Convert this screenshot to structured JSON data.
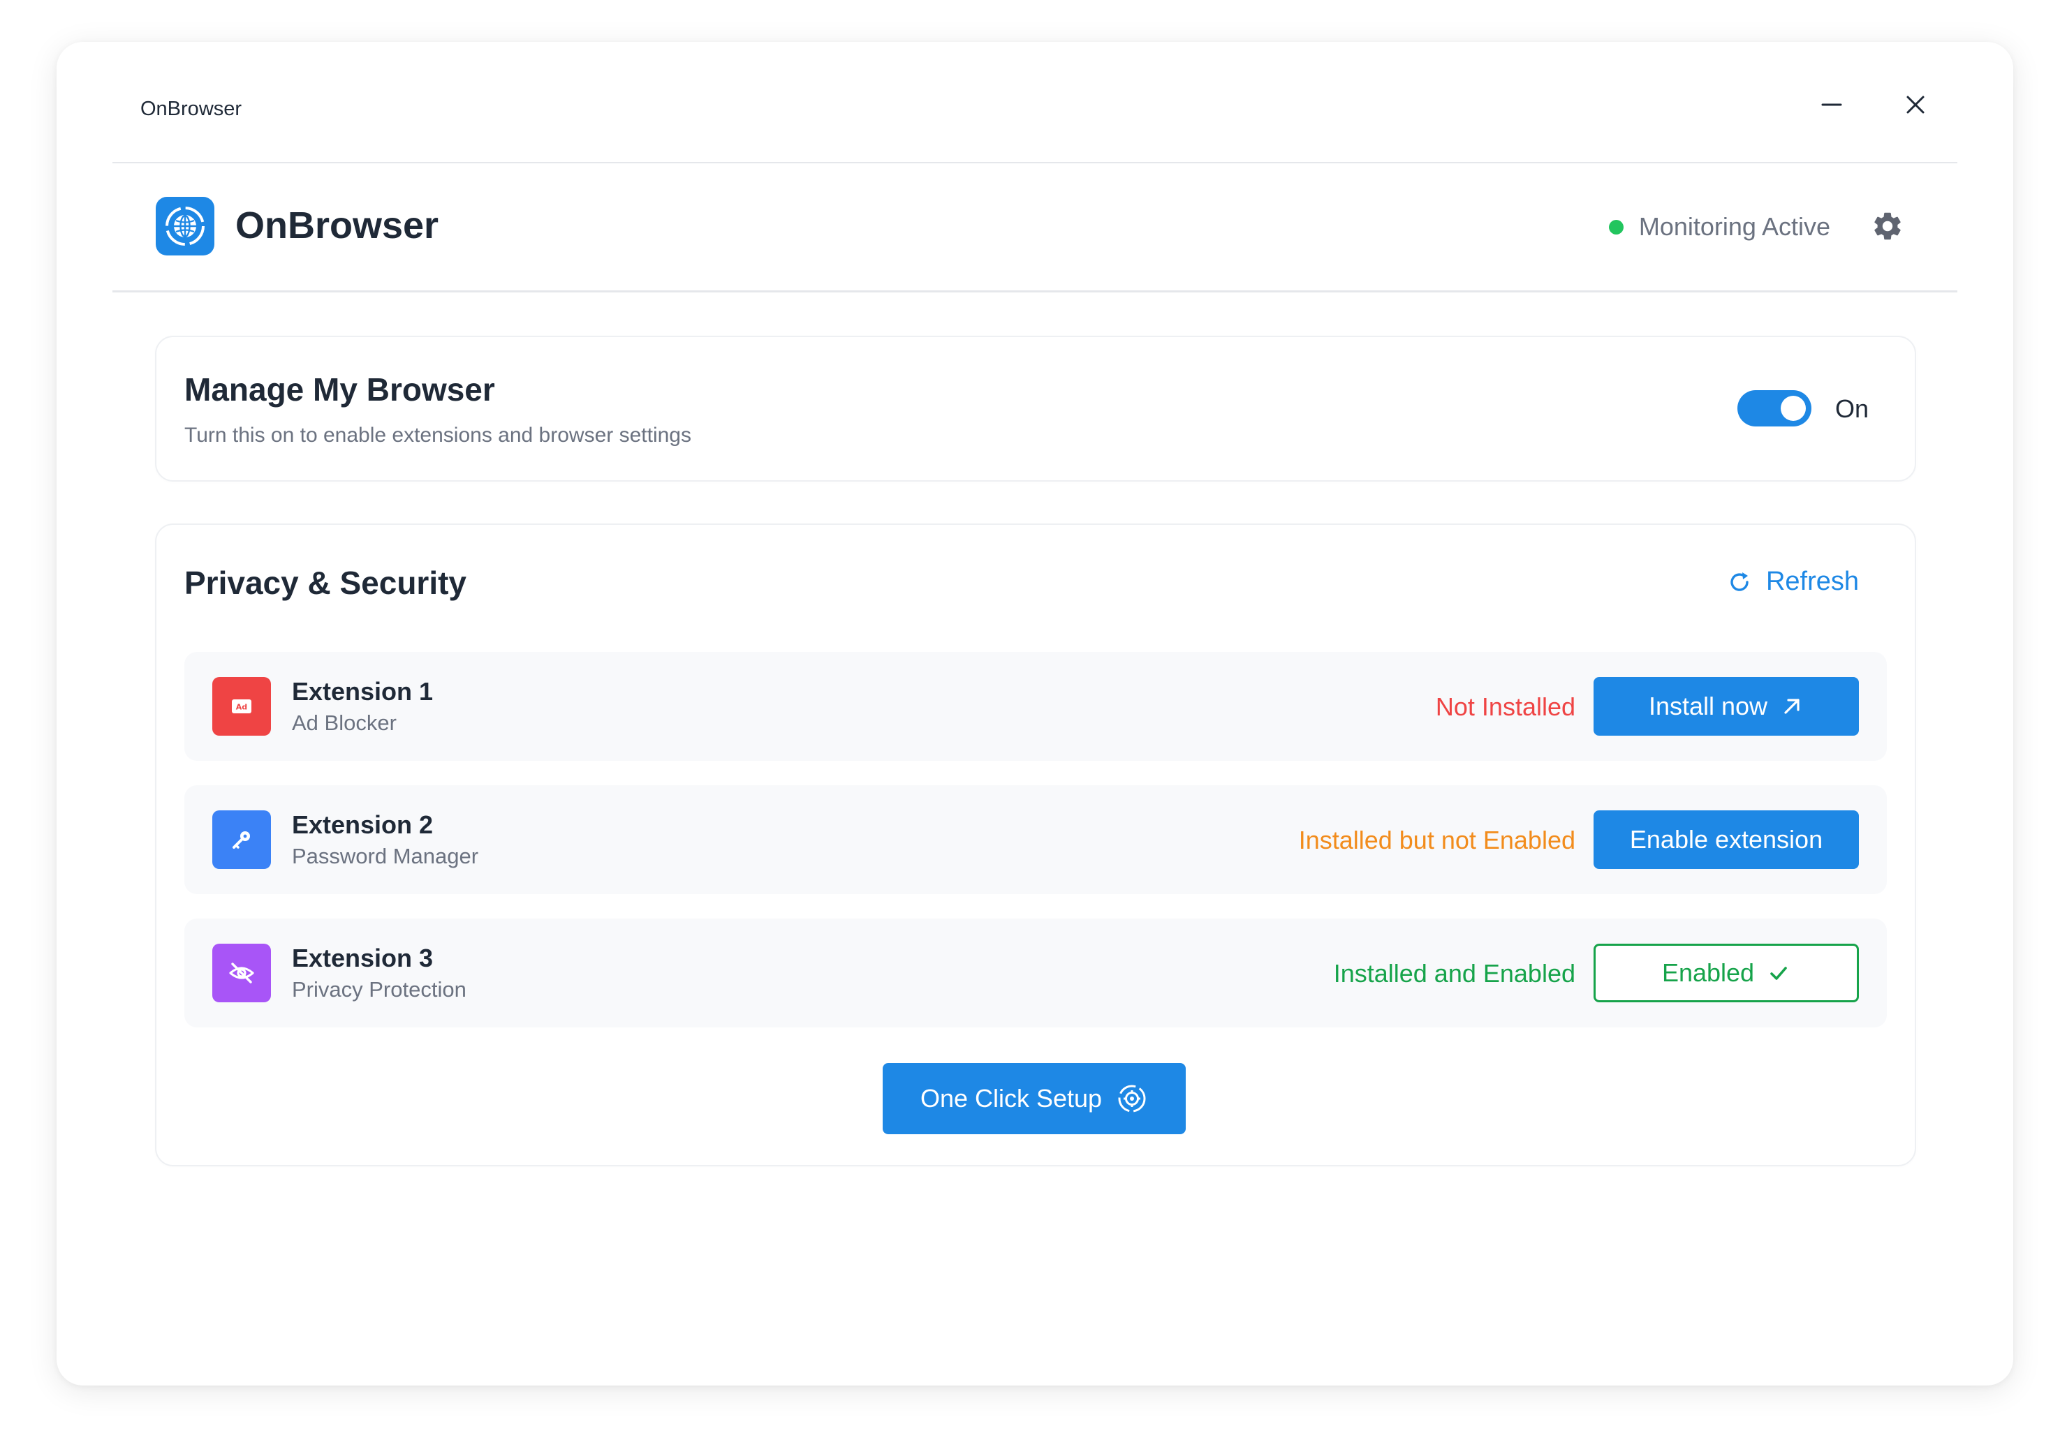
{
  "window": {
    "title": "OnBrowser"
  },
  "header": {
    "app_name": "OnBrowser",
    "status_text": "Monitoring Active",
    "icons": {
      "logo": "globe-icon",
      "settings": "gear-icon"
    }
  },
  "manage": {
    "title": "Manage My Browser",
    "subtitle": "Turn this on to enable extensions and browser settings",
    "toggle_label": "On",
    "toggle_on": true
  },
  "privacy": {
    "title": "Privacy & Security",
    "refresh_label": "Refresh",
    "extensions": [
      {
        "name": "Extension 1",
        "type": "Ad Blocker",
        "status": "Not Installed",
        "status_color": "#ef4444",
        "icon": "ad-icon",
        "icon_color": "#ef4444",
        "button_label": "Install now",
        "button_icon": "arrow-up-right-icon"
      },
      {
        "name": "Extension 2",
        "type": "Password Manager",
        "status": "Installed but not Enabled",
        "status_color": "#f28c1c",
        "icon": "key-icon",
        "icon_color": "#3b82f6",
        "button_label": "Enable extension",
        "button_icon": ""
      },
      {
        "name": "Extension 3",
        "type": "Privacy Protection",
        "status": "Installed and Enabled",
        "status_color": "#16a34a",
        "icon": "eye-off-icon",
        "icon_color": "#a855f7",
        "button_label": "Enabled",
        "button_icon": "check-icon"
      }
    ],
    "setup_label": "One Click Setup"
  },
  "colors": {
    "accent": "#1e88e5",
    "status_active": "#22c55e",
    "text_primary": "#1f2937",
    "text_secondary": "#6b7280"
  }
}
